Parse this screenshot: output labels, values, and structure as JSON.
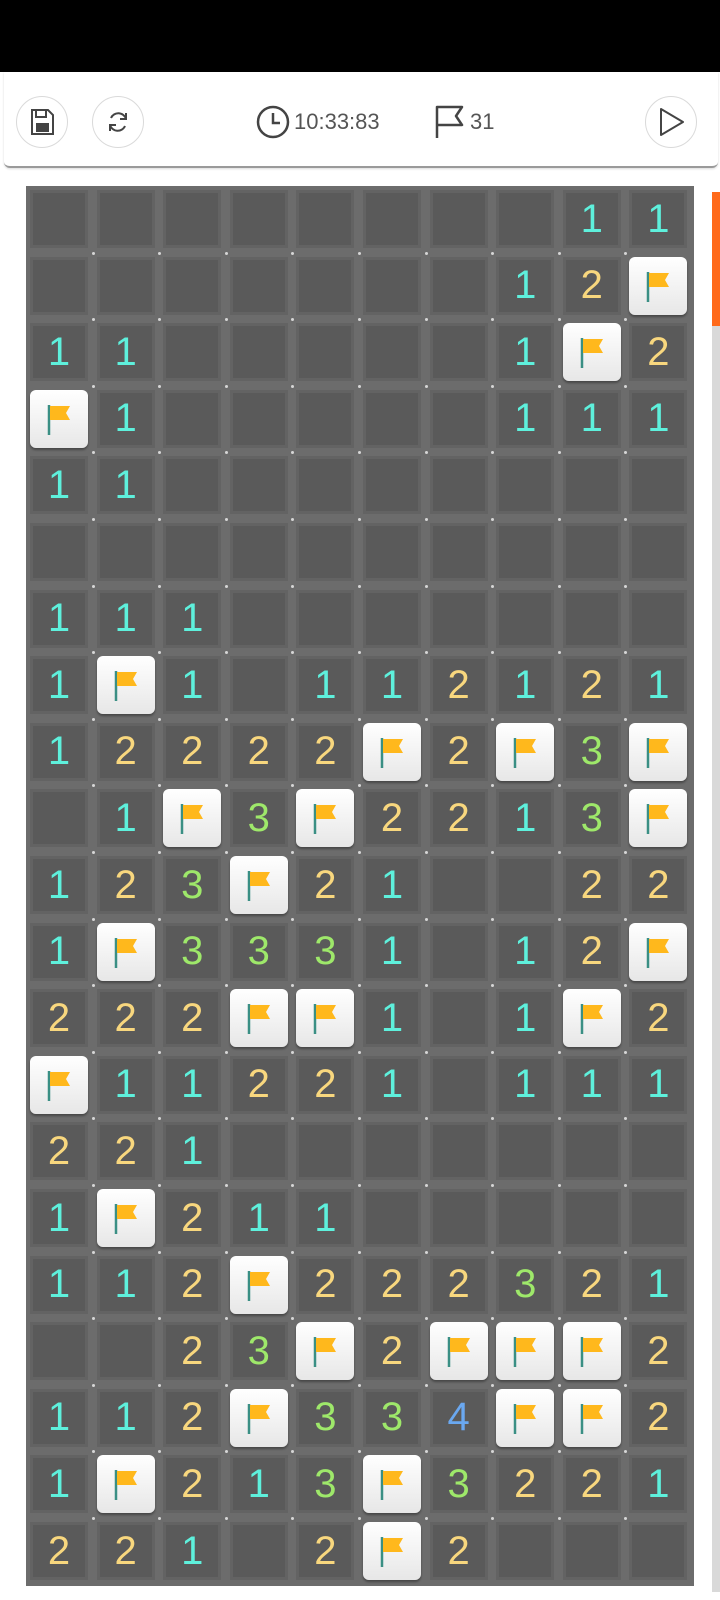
{
  "toolbar": {
    "timer": "10:33:83",
    "flags_count": "31",
    "icons": [
      "save-icon",
      "restart-icon",
      "clock-icon",
      "flag-icon",
      "play-icon"
    ]
  },
  "board": {
    "columns": 10,
    "rows": 21,
    "cells": [
      [
        "",
        "",
        "",
        "",
        "",
        "",
        "",
        "",
        "1",
        "1"
      ],
      [
        "",
        "",
        "",
        "",
        "",
        "",
        "",
        "1",
        "2",
        "F"
      ],
      [
        "1",
        "1",
        "",
        "",
        "",
        "",
        "",
        "1",
        "F",
        "2"
      ],
      [
        "F",
        "1",
        "",
        "",
        "",
        "",
        "",
        "1",
        "1",
        "1"
      ],
      [
        "1",
        "1",
        "",
        "",
        "",
        "",
        "",
        "",
        "",
        ""
      ],
      [
        "",
        "",
        "",
        "",
        "",
        "",
        "",
        "",
        "",
        ""
      ],
      [
        "1",
        "1",
        "1",
        "",
        "",
        "",
        "",
        "",
        "",
        ""
      ],
      [
        "1",
        "F",
        "1",
        "",
        "1",
        "1",
        "2",
        "1",
        "2",
        "1"
      ],
      [
        "1",
        "2",
        "2",
        "2",
        "2",
        "F",
        "2",
        "F",
        "3",
        "F"
      ],
      [
        "",
        "1",
        "F",
        "3",
        "F",
        "2",
        "2",
        "1",
        "3",
        "F"
      ],
      [
        "1",
        "2",
        "3",
        "F",
        "2",
        "1",
        "",
        "",
        "2",
        "2"
      ],
      [
        "1",
        "F",
        "3",
        "3",
        "3",
        "1",
        "",
        "1",
        "2",
        "F"
      ],
      [
        "2",
        "2",
        "2",
        "F",
        "F",
        "1",
        "",
        "1",
        "F",
        "2"
      ],
      [
        "F",
        "1",
        "1",
        "2",
        "2",
        "1",
        "",
        "1",
        "1",
        "1"
      ],
      [
        "2",
        "2",
        "1",
        "",
        "",
        "",
        "",
        "",
        "",
        ""
      ],
      [
        "1",
        "F",
        "2",
        "1",
        "1",
        "",
        "",
        "",
        "",
        ""
      ],
      [
        "1",
        "1",
        "2",
        "F",
        "2",
        "2",
        "2",
        "3",
        "2",
        "1"
      ],
      [
        "",
        "",
        "2",
        "3",
        "F",
        "2",
        "F",
        "F",
        "F",
        "2"
      ],
      [
        "1",
        "1",
        "2",
        "F",
        "3",
        "3",
        "4",
        "F",
        "F",
        "2"
      ],
      [
        "1",
        "F",
        "2",
        "1",
        "3",
        "F",
        "3",
        "2",
        "2",
        "1"
      ],
      [
        "2",
        "2",
        "1",
        "",
        "2",
        "F",
        "2",
        "",
        "",
        ""
      ]
    ]
  },
  "colors": {
    "1": "#5ef0dc",
    "2": "#f8d77e",
    "3": "#9ee86a",
    "4": "#6aa8f0",
    "flag": "#ffb81c",
    "scroll_accent": "#ff6a1a"
  }
}
